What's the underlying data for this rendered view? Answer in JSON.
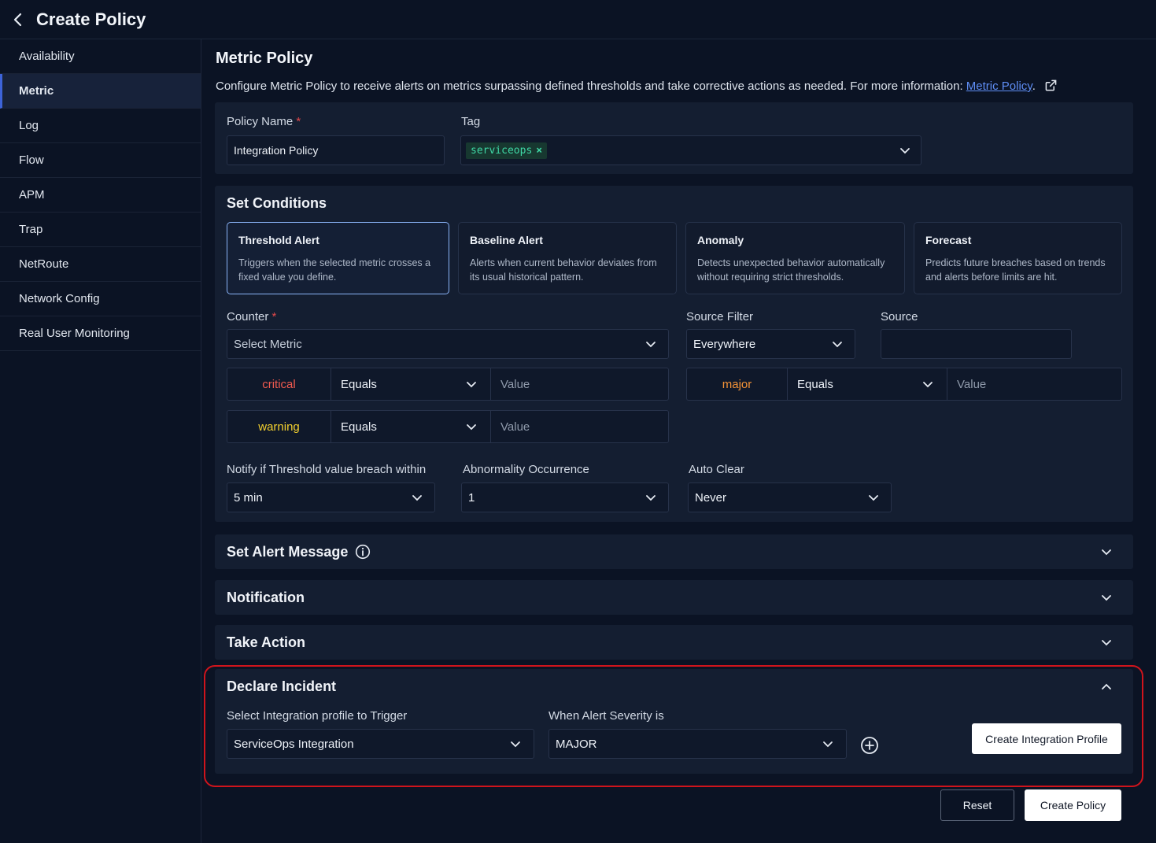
{
  "header": {
    "title": "Create Policy"
  },
  "sidebar": {
    "items": [
      {
        "label": "Availability",
        "active": false
      },
      {
        "label": "Metric",
        "active": true
      },
      {
        "label": "Log",
        "active": false
      },
      {
        "label": "Flow",
        "active": false
      },
      {
        "label": "APM",
        "active": false
      },
      {
        "label": "Trap",
        "active": false
      },
      {
        "label": "NetRoute",
        "active": false
      },
      {
        "label": "Network Config",
        "active": false
      },
      {
        "label": "Real User Monitoring",
        "active": false
      }
    ]
  },
  "main": {
    "title": "Metric Policy",
    "description": "Configure Metric Policy to receive alerts on metrics surpassing defined thresholds and take corrective actions as needed. For more information: ",
    "description_link": "Metric Policy",
    "description_end": ".",
    "policy_name": {
      "label": "Policy Name",
      "required": "*",
      "value": "Integration Policy"
    },
    "tag": {
      "label": "Tag",
      "chip": "serviceops",
      "remove": "×"
    }
  },
  "conditions": {
    "title": "Set Conditions",
    "cards": [
      {
        "title": "Threshold Alert",
        "desc": "Triggers when the selected metric crosses a fixed value you define.",
        "active": true
      },
      {
        "title": "Baseline Alert",
        "desc": "Alerts when current behavior deviates from its usual historical pattern.",
        "active": false
      },
      {
        "title": "Anomaly",
        "desc": "Detects unexpected behavior automatically without requiring strict thresholds.",
        "active": false
      },
      {
        "title": "Forecast",
        "desc": "Predicts future breaches based on trends and alerts before limits are hit.",
        "active": false
      }
    ],
    "counter": {
      "label": "Counter",
      "required": "*",
      "placeholder": "Select Metric"
    },
    "source_filter": {
      "label": "Source Filter",
      "value": "Everywhere"
    },
    "source": {
      "label": "Source",
      "value": ""
    },
    "severities": [
      {
        "name": "critical",
        "color": "#f05a4f",
        "operator": "Equals",
        "value_placeholder": "Value"
      },
      {
        "name": "major",
        "color": "#f29237",
        "operator": "Equals",
        "value_placeholder": "Value"
      },
      {
        "name": "warning",
        "color": "#f3d02f",
        "operator": "Equals",
        "value_placeholder": "Value"
      }
    ],
    "notify_within": {
      "label": "Notify if Threshold value breach within",
      "value": "5 min"
    },
    "abnormality": {
      "label": "Abnormality Occurrence",
      "value": "1"
    },
    "auto_clear": {
      "label": "Auto Clear",
      "value": "Never"
    }
  },
  "sections": {
    "alert_message": "Set Alert Message",
    "notification": "Notification",
    "take_action": "Take Action"
  },
  "incident": {
    "title": "Declare Incident",
    "integration_label": "Select Integration profile to Trigger",
    "integration_value": "ServiceOps Integration",
    "severity_label": "When Alert Severity is",
    "severity_value": "MAJOR",
    "create_profile_button": "Create Integration Profile"
  },
  "footer": {
    "reset": "Reset",
    "create": "Create Policy"
  },
  "colors": {
    "accent": "#3d63d8",
    "highlight": "#d0141c",
    "link": "#5f8ef5"
  }
}
